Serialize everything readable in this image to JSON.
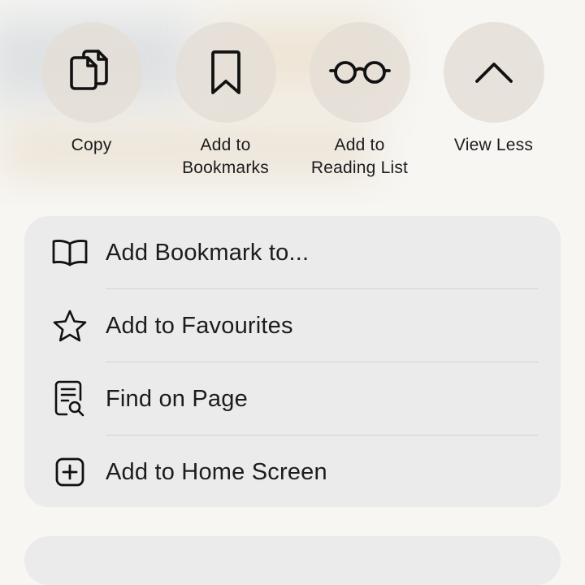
{
  "actions": [
    {
      "label": "Copy",
      "icon": "copy-icon"
    },
    {
      "label": "Add to\nBookmarks",
      "icon": "bookmark-icon"
    },
    {
      "label": "Add to\nReading List",
      "icon": "glasses-icon"
    },
    {
      "label": "View Less",
      "icon": "chevron-up-icon"
    }
  ],
  "menu": {
    "items": [
      {
        "label": "Add Bookmark to...",
        "icon": "book-icon"
      },
      {
        "label": "Add to Favourites",
        "icon": "star-icon"
      },
      {
        "label": "Find on Page",
        "icon": "find-page-icon"
      },
      {
        "label": "Add to Home Screen",
        "icon": "plus-square-icon"
      }
    ]
  },
  "colors": {
    "background": "#f7f6f3",
    "action_circle": "#e4ded6",
    "menu_card": "#ebebec",
    "text": "#1c1c1e",
    "divider": "#d3d3d6"
  }
}
